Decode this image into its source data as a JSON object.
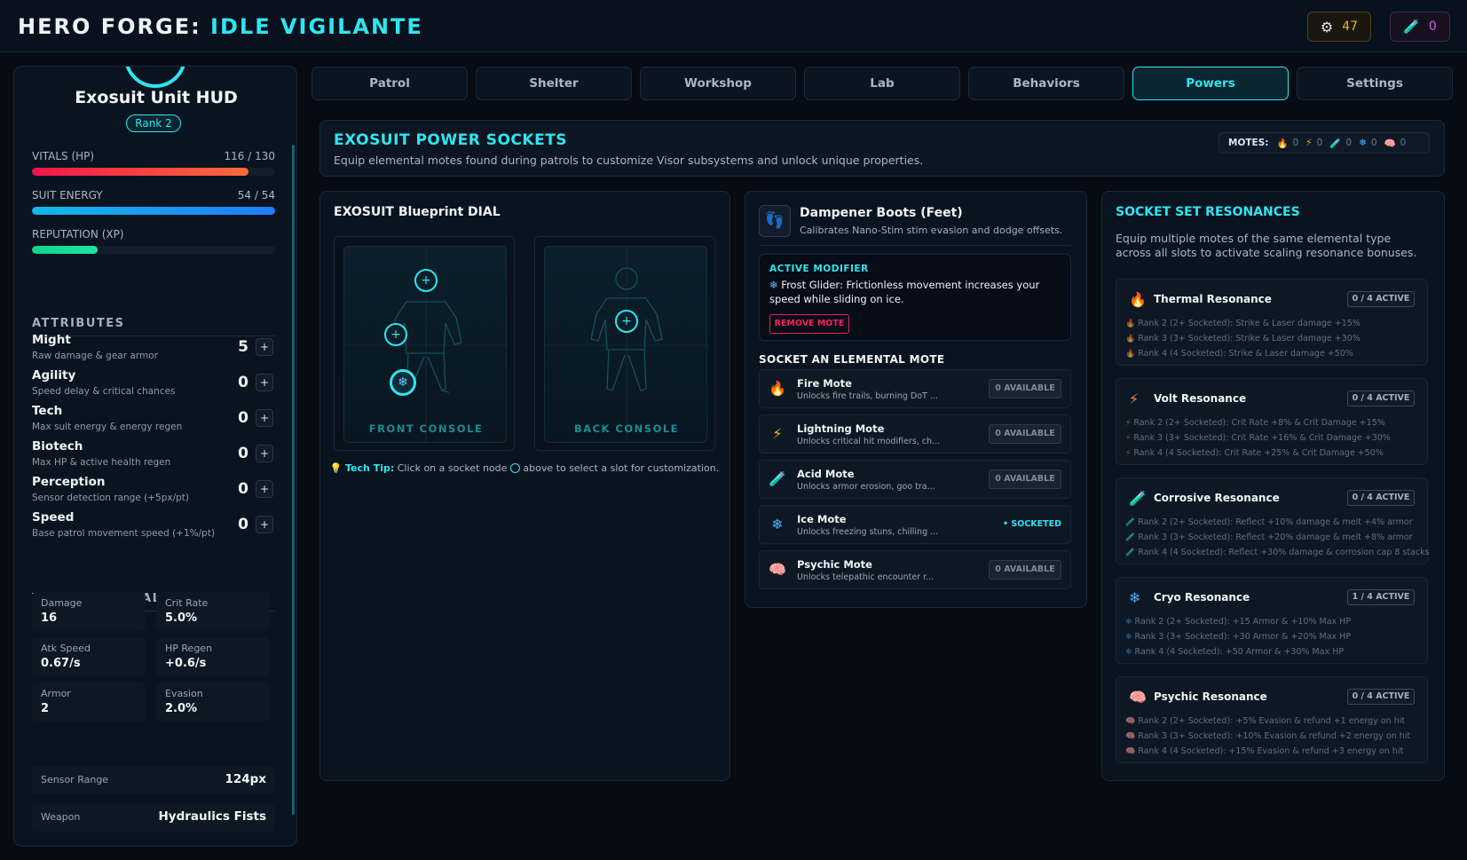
{
  "app": {
    "title_main": "HERO FORGE:",
    "title_accent": "IDLE VIGILANTE",
    "resources": [
      {
        "icon": "gear-icon",
        "value": "47"
      },
      {
        "icon": "acid-mote-icon",
        "value": "0"
      }
    ]
  },
  "sidebar": {
    "hud_title": "Exosuit Unit HUD",
    "rank": "Rank 2",
    "vitals": {
      "label": "VITALS (HP)",
      "value": "116 / 130",
      "fraction": 0.892
    },
    "energy": {
      "label": "SUIT ENERGY",
      "value": "54 / 54",
      "fraction": 1.0
    },
    "reputation": {
      "label": "REPUTATION (XP)",
      "fraction": 0.27
    },
    "attributes_title": "ATTRIBUTES",
    "attributes": [
      {
        "name": "Might",
        "desc": "Raw damage & gear armor",
        "value": "5"
      },
      {
        "name": "Agility",
        "desc": "Speed delay & critical chances",
        "value": "0"
      },
      {
        "name": "Tech",
        "desc": "Max suit energy & energy regen",
        "value": "0"
      },
      {
        "name": "Biotech",
        "desc": "Max HP & active health regen",
        "value": "0"
      },
      {
        "name": "Perception",
        "desc": "Sensor detection range (+5px/pt)",
        "value": "0"
      },
      {
        "name": "Speed",
        "desc": "Base patrol movement speed (+1%/pt)",
        "value": "0"
      }
    ],
    "plus_label": "+",
    "vitals_title": "VIGILANTE VITALS",
    "stats": [
      {
        "label": "Damage",
        "value": "16"
      },
      {
        "label": "Crit Rate",
        "value": "5.0%"
      },
      {
        "label": "Atk Speed",
        "value": "0.67/s"
      },
      {
        "label": "HP Regen",
        "value": "+0.6/s"
      },
      {
        "label": "Armor",
        "value": "2"
      },
      {
        "label": "Evasion",
        "value": "2.0%"
      }
    ],
    "sensor": {
      "label": "Sensor Range",
      "value": "124px"
    },
    "weapon": {
      "label": "Weapon",
      "value": "Hydraulics Fists"
    }
  },
  "tabs": [
    "Patrol",
    "Shelter",
    "Workshop",
    "Lab",
    "Behaviors",
    "Powers",
    "Settings"
  ],
  "active_tab": "Powers",
  "banner": {
    "title": "EXOSUIT POWER SOCKETS",
    "subtitle": "Equip elemental motes found during patrols to customize Visor subsystems and unlock unique properties.",
    "motes_label": "MOTES:",
    "motes": [
      {
        "icon": "fire-icon",
        "value": "0"
      },
      {
        "icon": "lightning-icon",
        "value": "0"
      },
      {
        "icon": "acid-icon",
        "value": "0"
      },
      {
        "icon": "ice-icon",
        "value": "0"
      },
      {
        "icon": "psychic-icon",
        "value": "0"
      }
    ]
  },
  "dial": {
    "title": "EXOSUIT Blueprint DIAL",
    "front_label": "FRONT CONSOLE",
    "back_label": "BACK CONSOLE",
    "tip_key": "Tech Tip:",
    "tip_text": "Click on a socket node",
    "tip_text2": "above to select a slot for customization."
  },
  "item": {
    "name": "Dampener Boots (Feet)",
    "desc": "Calibrates Nano-Stim stim evasion and dodge offsets.",
    "modifier_head": "ACTIVE MODIFIER",
    "modifier_text": "Frost Glider: Frictionless movement increases your speed while sliding on ice.",
    "remove_label": "REMOVE MOTE",
    "socket_head": "SOCKET AN ELEMENTAL MOTE",
    "motes": [
      {
        "name": "Fire Mote",
        "desc": "Unlocks fire trails, burning DoT ...",
        "status": "0 AVAILABLE",
        "color": "#ff7a1a",
        "glyph": "🔥"
      },
      {
        "name": "Lightning Mote",
        "desc": "Unlocks critical hit modifiers, ch...",
        "status": "0 AVAILABLE",
        "color": "#ffb020",
        "glyph": "⚡"
      },
      {
        "name": "Acid Mote",
        "desc": "Unlocks armor erosion, goo tra...",
        "status": "0 AVAILABLE",
        "color": "#7de84a",
        "glyph": "🧪"
      },
      {
        "name": "Ice Mote",
        "desc": "Unlocks freezing stuns, chilling ...",
        "status": "• SOCKETED",
        "color": "#4fb0ff",
        "glyph": "❄"
      },
      {
        "name": "Psychic Mote",
        "desc": "Unlocks telepathic encounter r...",
        "status": "0 AVAILABLE",
        "color": "#ff6fb6",
        "glyph": "🧠"
      }
    ]
  },
  "resonances": {
    "title": "SOCKET SET RESONANCES",
    "subtitle": "Equip multiple motes of the same elemental type across all slots to activate scaling resonance bonuses.",
    "sets": [
      {
        "name": "Thermal Resonance",
        "active": "0 / 4 ACTIVE",
        "color": "#ff7a1a",
        "glyph": "🔥",
        "ranks": [
          "Rank 2 (2+ Socketed): Strike & Laser damage +15%",
          "Rank 3 (3+ Socketed): Strike & Laser damage +30%",
          "Rank 4 (4 Socketed): Strike & Laser damage +50%"
        ]
      },
      {
        "name": "Volt Resonance",
        "active": "0 / 4 ACTIVE",
        "color": "#ff8a30",
        "glyph": "⚡",
        "ranks": [
          "Rank 2 (2+ Socketed): Crit Rate +8% & Crit Damage +15%",
          "Rank 3 (3+ Socketed): Crit Rate +16% & Crit Damage +30%",
          "Rank 4 (4 Socketed): Crit Rate +25% & Crit Damage +50%"
        ]
      },
      {
        "name": "Corrosive Resonance",
        "active": "0 / 4 ACTIVE",
        "color": "#7de84a",
        "glyph": "🧪",
        "ranks": [
          "Rank 2 (2+ Socketed): Reflect +10% damage & melt +4% armor",
          "Rank 3 (3+ Socketed): Reflect +20% damage & melt +8% armor",
          "Rank 4 (4 Socketed): Reflect +30% damage & corrosion cap 8 stacks"
        ]
      },
      {
        "name": "Cryo Resonance",
        "active": "1 / 4 ACTIVE",
        "color": "#4fb0ff",
        "glyph": "❄",
        "ranks": [
          "Rank 2 (2+ Socketed): +15 Armor & +10% Max HP",
          "Rank 3 (3+ Socketed): +30 Armor & +20% Max HP",
          "Rank 4 (4 Socketed): +50 Armor & +30% Max HP"
        ]
      },
      {
        "name": "Psychic Resonance",
        "active": "0 / 4 ACTIVE",
        "color": "#ff6fb6",
        "glyph": "🧠",
        "ranks": [
          "Rank 2 (2+ Socketed): +5% Evasion & refund +1 energy on hit",
          "Rank 3 (3+ Socketed): +10% Evasion & refund +2 energy on hit",
          "Rank 4 (4 Socketed): +15% Evasion & refund +3 energy on hit"
        ]
      }
    ]
  }
}
